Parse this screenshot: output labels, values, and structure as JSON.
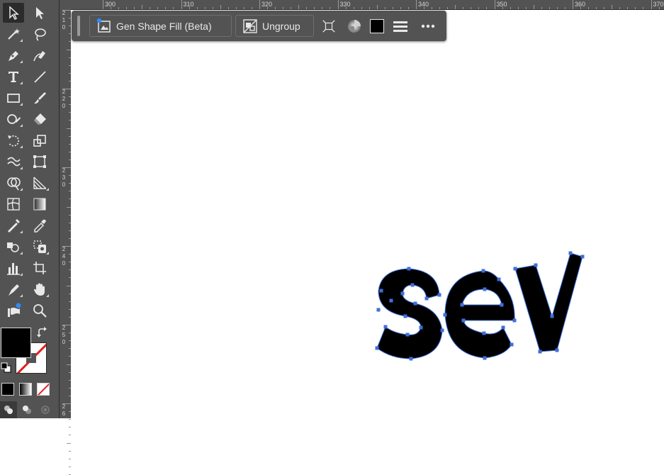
{
  "ruler": {
    "horizontal_labels": [
      "300",
      "310",
      "320",
      "330",
      "340",
      "350",
      "360",
      "370"
    ],
    "vertical_labels": [
      [
        "2",
        "1",
        "0"
      ],
      [
        "2",
        "2",
        "0"
      ],
      [
        "2",
        "3",
        "0"
      ],
      [
        "2",
        "4",
        "0"
      ],
      [
        "2",
        "5",
        "0"
      ],
      [
        "2",
        "6"
      ]
    ]
  },
  "taskbar": {
    "gen_shape_fill_label": "Gen Shape Fill (Beta)",
    "ungroup_label": "Ungroup"
  },
  "colors": {
    "fill": "#000000",
    "stroke": "none",
    "selection_accent": "#3f6fdc",
    "ui_dark": "#535353"
  },
  "icons": {
    "tools": [
      "selection",
      "direct-selection",
      "magic-wand",
      "lasso",
      "pen",
      "curvature",
      "type",
      "line",
      "rectangle",
      "paintbrush",
      "shaper",
      "eraser",
      "rotate",
      "scale",
      "warp",
      "free-transform",
      "shape-builder",
      "perspective-grid",
      "mesh",
      "gradient",
      "eyedropper-measure",
      "eyedropper",
      "blend",
      "live-paint",
      "column-graph",
      "artboard",
      "slice",
      "hand",
      "generative-recolor",
      "zoom"
    ]
  }
}
